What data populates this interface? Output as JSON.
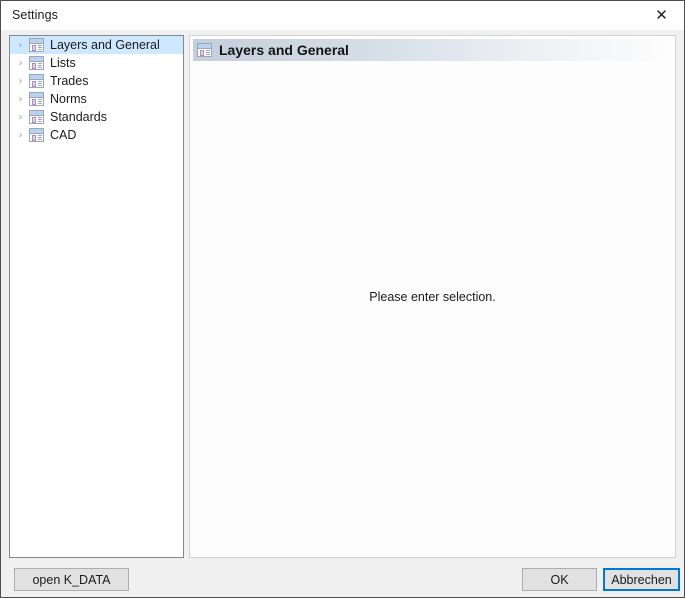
{
  "window": {
    "title": "Settings",
    "close_glyph": "✕"
  },
  "sidebar": {
    "items": [
      {
        "label": "Layers and General",
        "expander": "›",
        "selected": true
      },
      {
        "label": "Lists",
        "expander": "›",
        "selected": false
      },
      {
        "label": "Trades",
        "expander": "›",
        "selected": false
      },
      {
        "label": "Norms",
        "expander": "›",
        "selected": false
      },
      {
        "label": "Standards",
        "expander": "›",
        "selected": false
      },
      {
        "label": "CAD",
        "expander": "›",
        "selected": false
      }
    ]
  },
  "content": {
    "header_title": "Layers and General",
    "empty_message": "Please enter selection."
  },
  "footer": {
    "open_kdata_label": "open K_DATA",
    "ok_label": "OK",
    "cancel_label": "Abbrechen"
  },
  "colors": {
    "selection": "#cde8ff",
    "focus_border": "#0078d7",
    "window_bg": "#f0f0f0"
  }
}
